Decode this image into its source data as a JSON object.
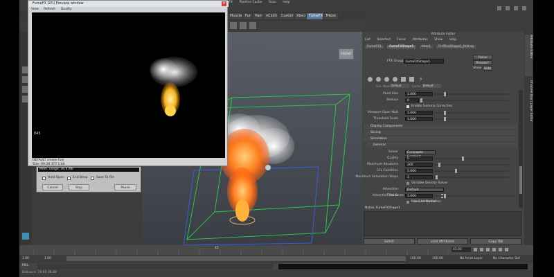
{
  "maya": {
    "top_menus": [
      "FumeFX",
      "Pipeline Cache",
      "Scan",
      "Help"
    ],
    "shelf_tabs": [
      "Muscle",
      "Fur",
      "Hair",
      "nCloth",
      "Custom",
      "XGen",
      "FumeFX",
      "TRexk"
    ],
    "active_shelf": "FumeFX",
    "viewport_nav": "FRONT"
  },
  "preview_window": {
    "title": "FumeFX GPU Preview window",
    "menu": [
      "View",
      "Refresh",
      "Quality"
    ],
    "frame_label": "045",
    "channel_label": "DEFAULT smoke fuel",
    "size_label": "Size: 89.38 377 1.00"
  },
  "sim_panel": {
    "mem_text": "Mem. usage: 36.4 Mb",
    "hold_open": "Hold Open",
    "end_beep": "End Beep",
    "save_file": "Save To File",
    "cancel": "Cancel",
    "stop": "Stop",
    "pause": "Pause"
  },
  "attr_editor": {
    "title": "Attribute Editor",
    "menu": [
      "List",
      "Selected",
      "Focus",
      "Attributes",
      "Show",
      "Help"
    ],
    "tabs": [
      "FumeFX1",
      "FumeFXShape1",
      "time1",
      "FI-ffFireShape1_feld.sp"
    ],
    "node_label": "FFX Group:",
    "node_value": "FumeFXShape1",
    "focus_btn": "Focus",
    "presets_btn": "Presets*",
    "show_btn": "Show",
    "hide_btn": "Hide",
    "sim_mode_label": "Sim. Mode",
    "sim_mode_value": "Default",
    "cache_label": "Cache",
    "cache_value": "Default",
    "top_rows": [
      {
        "label": "Point Size",
        "value": "1.000"
      },
      {
        "label": "Reduce",
        "value": "0"
      },
      {
        "label": "",
        "value": "Enable Gamma Correction"
      },
      {
        "label": "Viewport Opac Mult",
        "value": "1.000"
      },
      {
        "label": "Threshold Scale",
        "value": "1.000"
      }
    ],
    "sections": [
      "Display Components",
      "Slicing",
      "Simulation",
      "General"
    ],
    "general_rows": [
      {
        "label": "Solver",
        "value": "Conjugate Gradient"
      },
      {
        "label": "Quality",
        "value": "5"
      },
      {
        "label": "Maximum Iterations",
        "value": "200"
      },
      {
        "label": "CFL Condition",
        "value": "5.000"
      },
      {
        "label": "Maximum Simulation Steps",
        "value": "1"
      },
      {
        "label": "",
        "value": "Variable Density Solver"
      },
      {
        "label": "Advection",
        "value": "Default"
      },
      {
        "label": "Advection Stride",
        "value": "0.500"
      },
      {
        "label": "",
        "value": "Cubic Interpolation"
      },
      {
        "label": "Time Scale",
        "value": "1.000"
      },
      {
        "label": "",
        "value": "Use Grid Motion"
      }
    ],
    "notes_label": "Notes: FumeFXShape1",
    "select_btn": "Select",
    "load_btn": "Load Attributes",
    "copy_btn": "Copy Tab"
  },
  "side_tabs": [
    "Attribute Editor",
    "Channel Box / Layer Editor"
  ],
  "timeline": {
    "start": "1.00",
    "range_start": "1.00",
    "range_end": "100.00",
    "end": "100.00",
    "current_frame": "45.00",
    "current_marker": "45",
    "anim_layer": "No Anim Layer",
    "char_set": "No Character Set"
  },
  "command_line": {
    "label": "MEL"
  },
  "status": {
    "text": "Distance: 29.60  36.88"
  },
  "colors": {
    "shelf_active": "#5d7a9a",
    "grid_green": "#28c84a",
    "grid_blue": "#3a5ce0",
    "fire_orange": "#ff7a1a",
    "ui_gray": "#444444"
  }
}
